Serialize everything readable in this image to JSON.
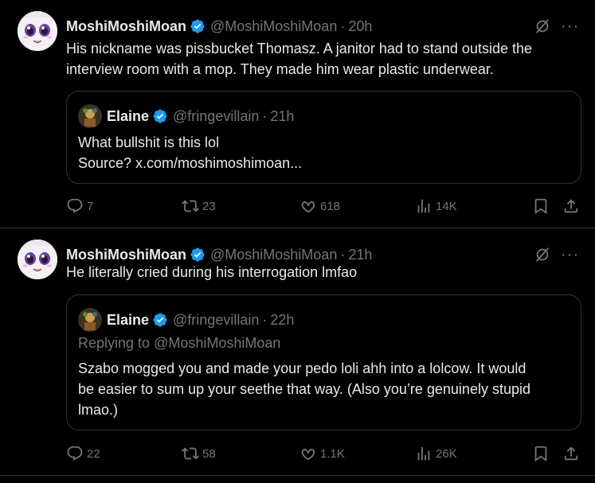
{
  "tweets": [
    {
      "author": {
        "name": "MoshiMoshiMoan",
        "handle": "@MoshiMoshiMoan",
        "time": "20h"
      },
      "text_lines": [
        "His nickname was pissbucket Thomasz.  A janitor had to stand outside the",
        "interview room with a mop.  They made him wear plastic underwear."
      ],
      "quote": {
        "author": {
          "name": "Elaine",
          "handle": "@fringevillain",
          "time": "21h"
        },
        "text_lines": [
          "What bullshit is this lol",
          "Source? x.com/moshimoshimoan..."
        ]
      },
      "actions": {
        "replies": "7",
        "reposts": "23",
        "likes": "618",
        "views": "14K"
      }
    },
    {
      "author": {
        "name": "MoshiMoshiMoan",
        "handle": "@MoshiMoshiMoan",
        "time": "21h"
      },
      "text_lines": [
        "He literally cried during his interrogation lmfao"
      ],
      "quote": {
        "author": {
          "name": "Elaine",
          "handle": "@fringevillain",
          "time": "22h"
        },
        "replying_to": "Replying to @MoshiMoshiMoan",
        "text_lines": [
          "Szabo mogged you and made your pedo loli ahh into a lolcow. It would",
          "be easier to sum up your seethe that way. (Also you’re genuinely stupid",
          "lmao.)"
        ]
      },
      "actions": {
        "replies": "22",
        "reposts": "58",
        "likes": "1.1K",
        "views": "26K"
      }
    }
  ],
  "ui": {
    "separator": "·",
    "more": "···"
  },
  "colors": {
    "background": "#000000",
    "text": "#e7e9ea",
    "muted": "#71767b",
    "border": "#2f3336",
    "verified": "#1d9bf0"
  },
  "icons": [
    "verified-badge-icon",
    "grok-icon",
    "more-icon",
    "reply-icon",
    "repost-icon",
    "like-icon",
    "views-icon",
    "bookmark-icon",
    "share-icon"
  ]
}
